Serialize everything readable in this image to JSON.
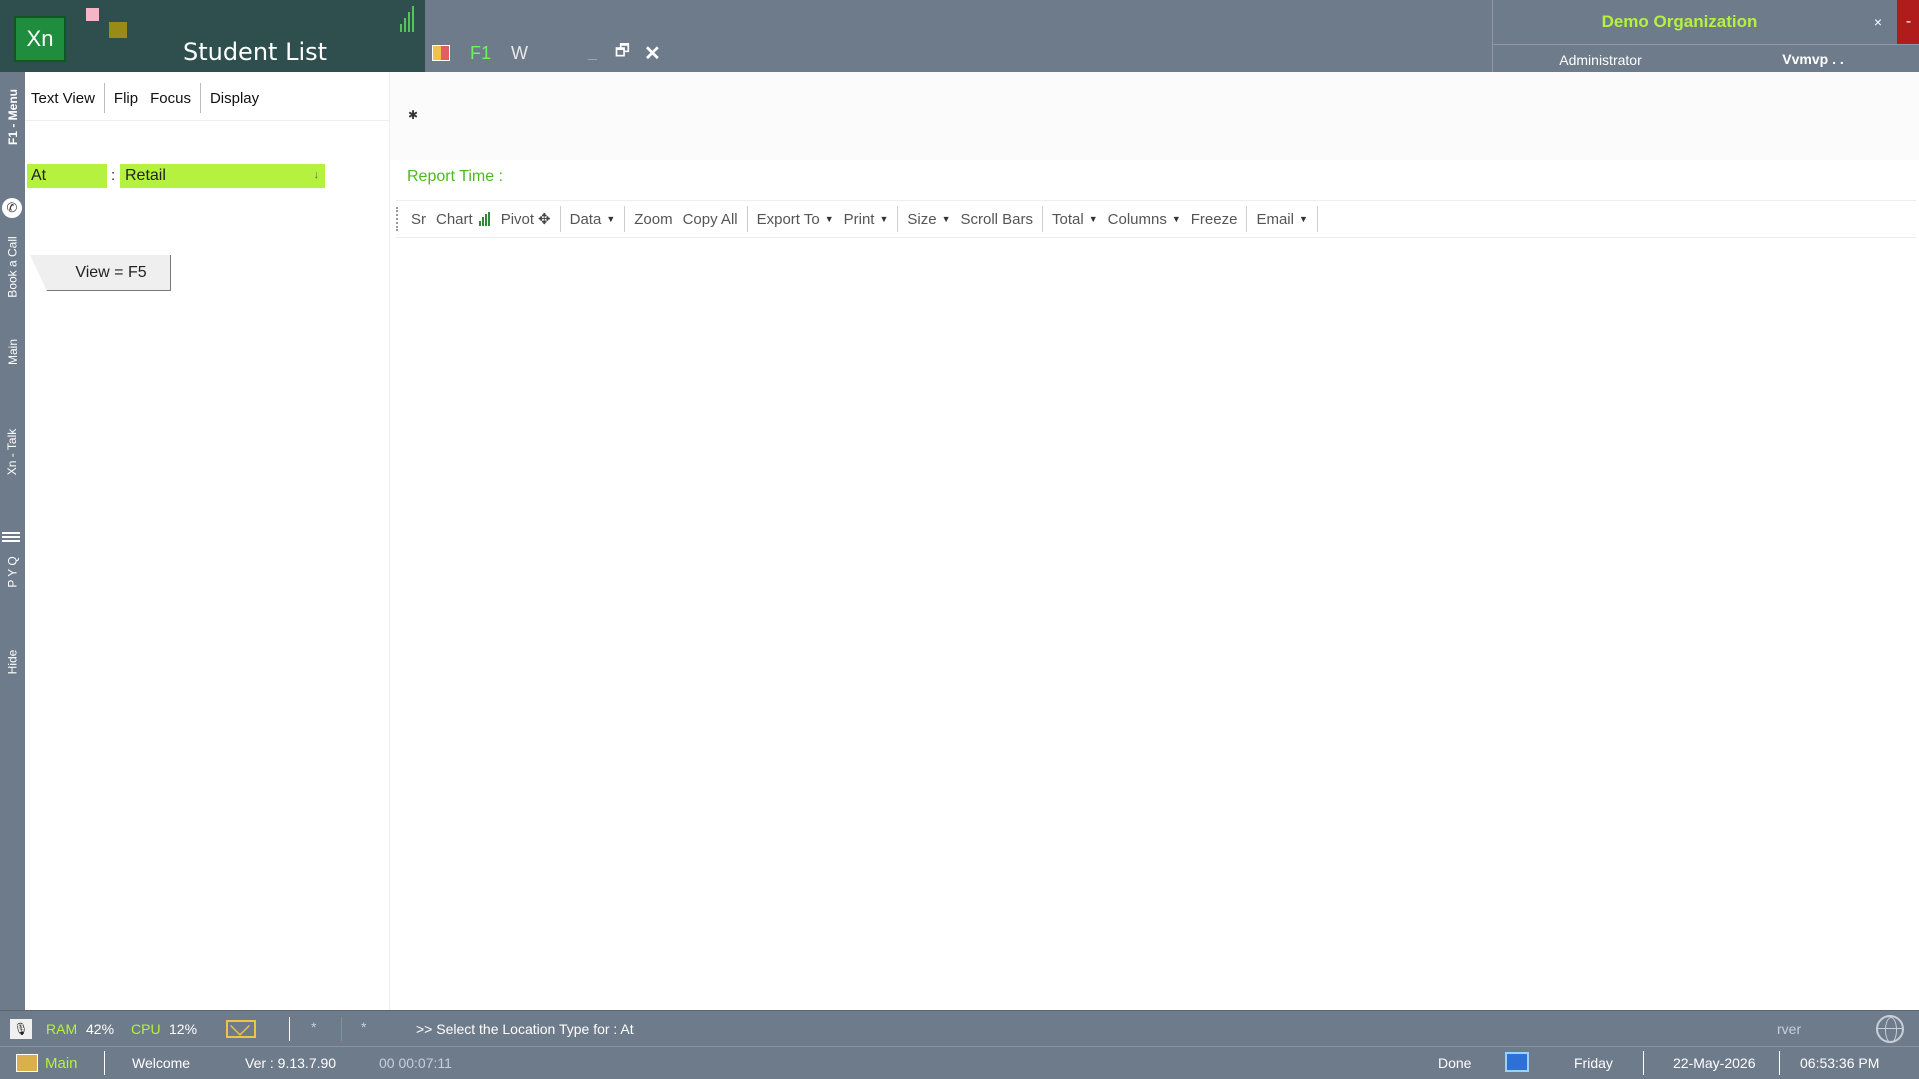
{
  "window": {
    "logo_text": "Xn",
    "title": "Student List",
    "f1_label": "F1",
    "w_label": "W",
    "minimize_glyph": "_",
    "restore_glyph": "🗗",
    "close_glyph": "✕"
  },
  "org": {
    "name": "Demo Organization",
    "role": "Administrator",
    "user": "Vvmvp . .",
    "close_glyph": "×",
    "min_glyph": "-"
  },
  "vnav": {
    "items": [
      {
        "label": "F1 - Menu"
      },
      {
        "label": "Book a Call"
      },
      {
        "label": "Main"
      },
      {
        "label": "Xn - Talk"
      },
      {
        "label": "P Y Q"
      },
      {
        "label": "Hide"
      }
    ],
    "phone_glyph": "✆"
  },
  "left_panel": {
    "tabs": [
      "Text View",
      "Flip",
      "Focus",
      "Display"
    ],
    "at_label": "At",
    "colon": ":",
    "location_value": "Retail",
    "location_chevron": "↓",
    "view_button": "View = F5"
  },
  "main": {
    "header_marker": "✱",
    "report_time_label": "Report Time :",
    "toolbar": {
      "sr": "Sr",
      "chart": "Chart",
      "pivot": "Pivot",
      "move_glyph": "✥",
      "data": "Data",
      "zoom": "Zoom",
      "copy_all": "Copy All",
      "export_to": "Export To",
      "print": "Print",
      "size": "Size",
      "scroll_bars": "Scroll Bars",
      "total": "Total",
      "columns": "Columns",
      "freeze": "Freeze",
      "email": "Email",
      "caret": "▼"
    }
  },
  "status": {
    "mic_glyph": "🎙",
    "ram_label": "RAM",
    "ram_value": "42%",
    "cpu_label": "CPU",
    "cpu_value": "12%",
    "marker1": "*",
    "marker2": "*",
    "message": ">>  Select the Location Type for : At",
    "server_text": "rver",
    "home_label": "Main",
    "welcome": "Welcome",
    "version": "Ver : 9.13.7.90",
    "elapsed": "00 00:07:11",
    "state": "Done",
    "day": "Friday",
    "date": "22-May-2026",
    "time": "06:53:36 PM"
  },
  "colors": {
    "accent_lime": "#b4f23f",
    "title_bg": "#6e7b8b",
    "logo_green": "#1e8e3e",
    "close_red": "#b01c1c",
    "report_time_green": "#4fb81f"
  },
  "icons": {
    "app_logo": "xn-logo-icon",
    "signal": "signal-bars-icon",
    "grid": "grid-tool-icon",
    "phone": "phone-icon",
    "menu_lines": "menu-lines-icon",
    "chart_bars": "chart-bars-icon",
    "move": "move-icon",
    "mic": "microphone-icon",
    "mail": "mail-icon",
    "globe": "globe-icon",
    "home": "home-icon",
    "monitor": "monitor-icon"
  }
}
